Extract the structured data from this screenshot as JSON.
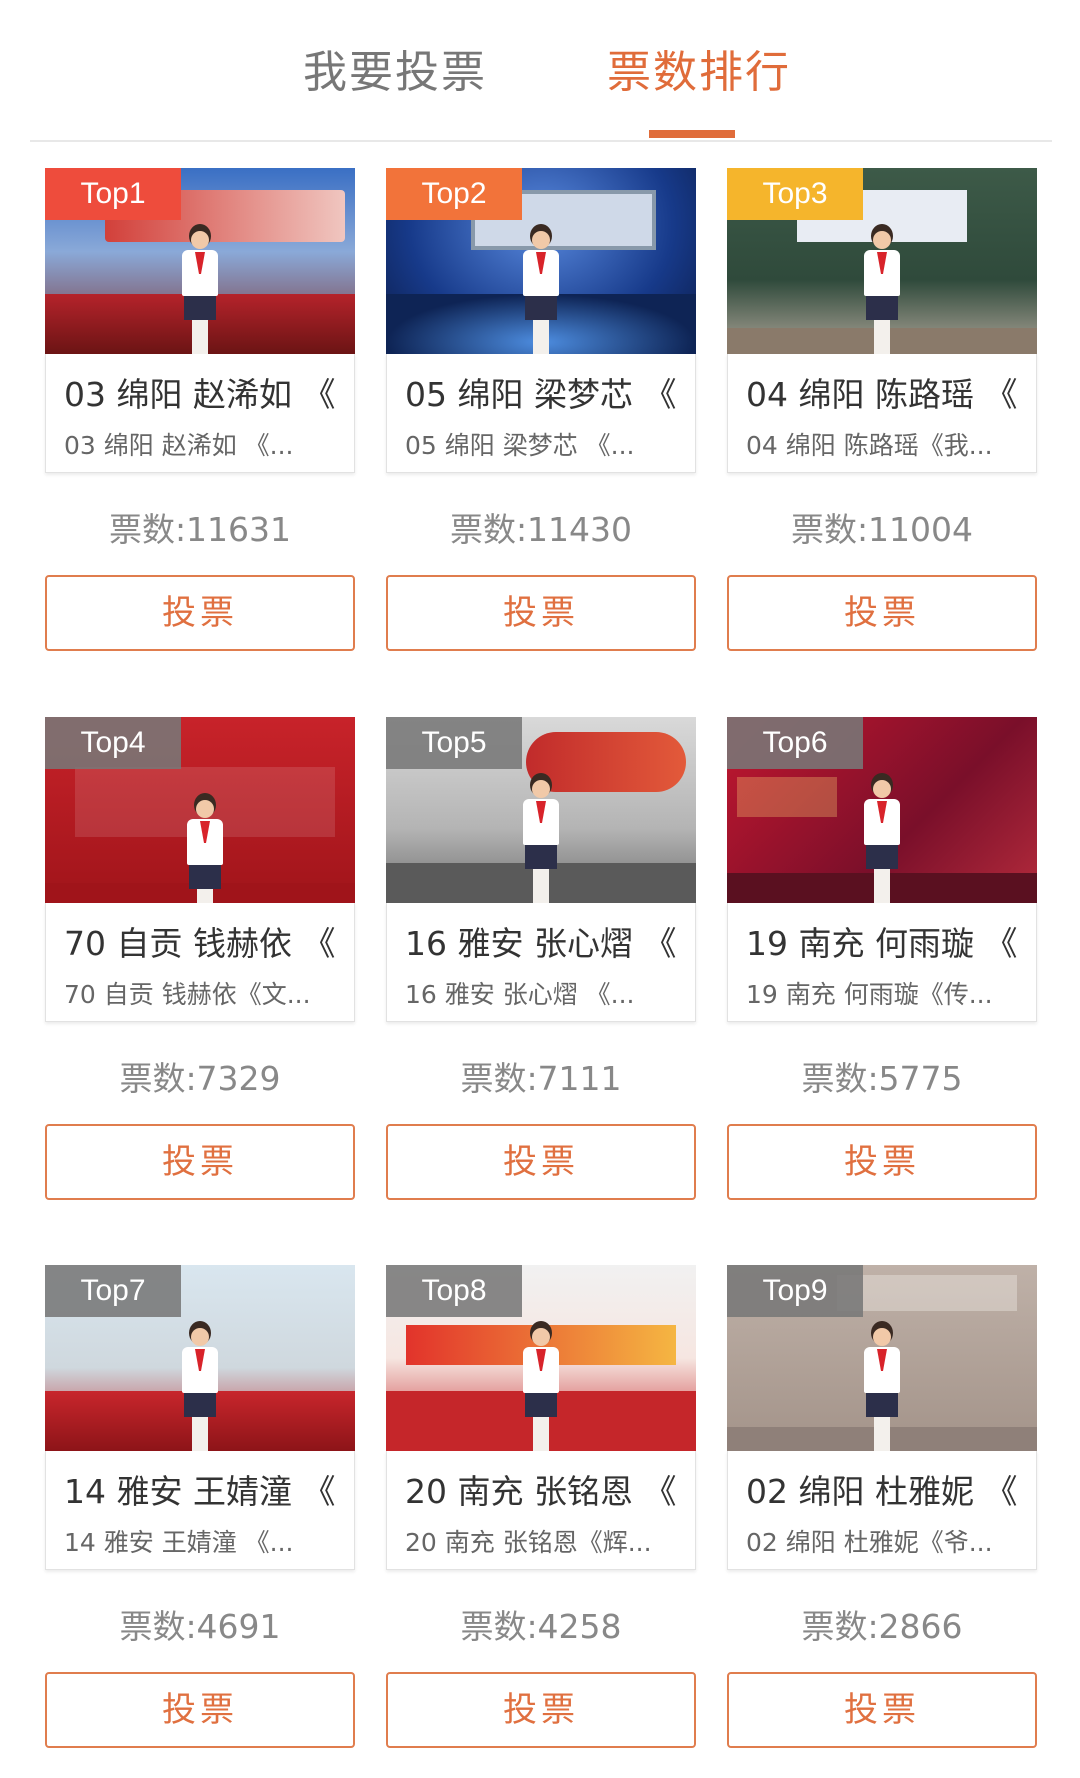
{
  "tabs": [
    {
      "label": "我要投票"
    },
    {
      "label": "票数排行"
    }
  ],
  "vote_prefix": "票数:",
  "colors": {
    "accent": "#e06c3a",
    "badge_top1": "#ee4c3c",
    "badge_top2": "#f2733a",
    "badge_top3": "#f5b52c",
    "badge_other": "#8a8a8a"
  },
  "entries": [
    {
      "rank": "Top1",
      "title": "03 绵阳 赵浠如 《",
      "subtitle": "03 绵阳 赵浠如 《...",
      "votes": "票数:11631",
      "button": "投票"
    },
    {
      "rank": "Top2",
      "title": "05 绵阳 梁梦芯 《",
      "subtitle": "05 绵阳 梁梦芯 《...",
      "votes": "票数:11430",
      "button": "投票"
    },
    {
      "rank": "Top3",
      "title": "04 绵阳 陈路瑶 《",
      "subtitle": "04 绵阳 陈路瑶《我...",
      "votes": "票数:11004",
      "button": "投票"
    },
    {
      "rank": "Top4",
      "title": "70 自贡 钱赫依 《",
      "subtitle": "70 自贡 钱赫依《文...",
      "votes": "票数:7329",
      "button": "投票"
    },
    {
      "rank": "Top5",
      "title": "16 雅安 张心熠 《",
      "subtitle": "16 雅安 张心熠 《...",
      "votes": "票数:7111",
      "button": "投票"
    },
    {
      "rank": "Top6",
      "title": "19 南充 何雨璇 《",
      "subtitle": "19 南充 何雨璇《传...",
      "votes": "票数:5775",
      "button": "投票"
    },
    {
      "rank": "Top7",
      "title": "14 雅安 王婧潼 《",
      "subtitle": "14 雅安 王婧潼 《...",
      "votes": "票数:4691",
      "button": "投票"
    },
    {
      "rank": "Top8",
      "title": "20 南充 张铭恩 《",
      "subtitle": "20 南充 张铭恩《辉...",
      "votes": "票数:4258",
      "button": "投票"
    },
    {
      "rank": "Top9",
      "title": "02 绵阳 杜雅妮 《",
      "subtitle": "02 绵阳 杜雅妮《爷...",
      "votes": "票数:2866",
      "button": "投票"
    }
  ]
}
